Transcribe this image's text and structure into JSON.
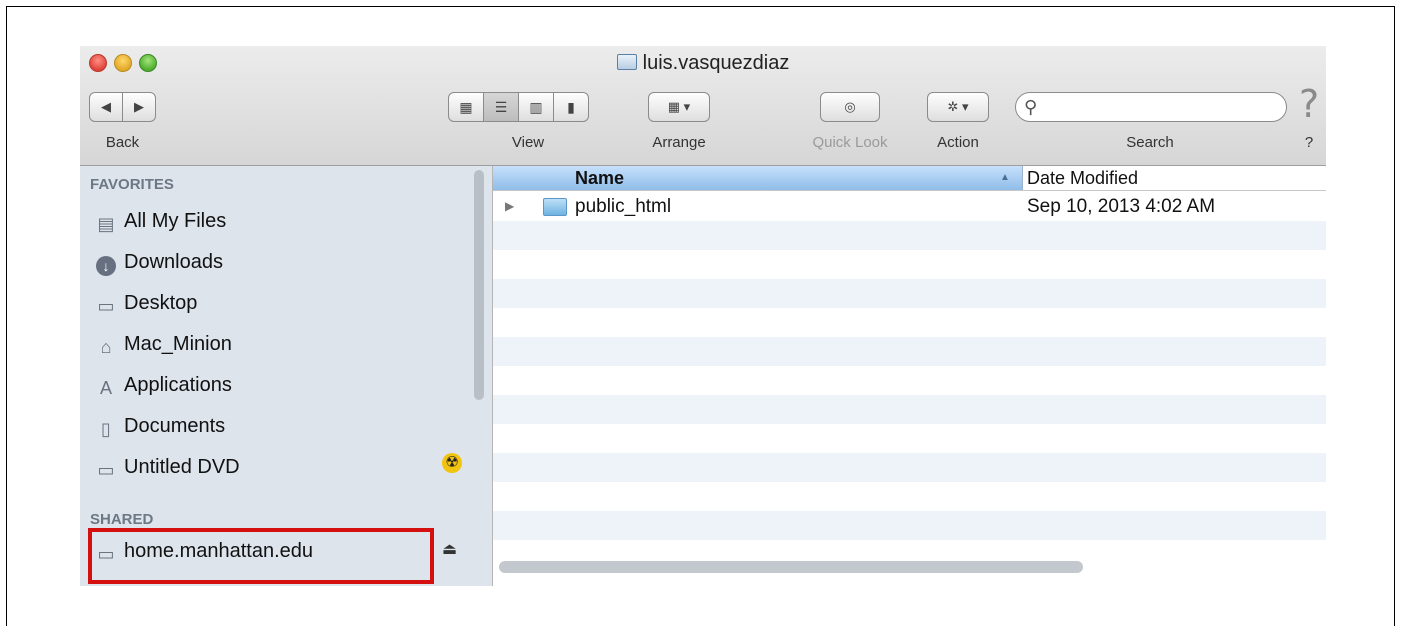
{
  "window": {
    "title": "luis.vasquezdiaz"
  },
  "toolbar": {
    "back_label": "Back",
    "view_label": "View",
    "arrange_label": "Arrange",
    "quicklook_label": "Quick Look",
    "action_label": "Action",
    "search_label": "Search",
    "help_label": "?",
    "search_placeholder": "",
    "help_glyph": "?"
  },
  "sidebar": {
    "favorites_header": "FAVORITES",
    "shared_header": "SHARED",
    "favorites": [
      {
        "label": "All My Files",
        "icon": "all-my-files-icon"
      },
      {
        "label": "Downloads",
        "icon": "downloads-icon"
      },
      {
        "label": "Desktop",
        "icon": "desktop-icon"
      },
      {
        "label": "Mac_Minion",
        "icon": "home-icon"
      },
      {
        "label": "Applications",
        "icon": "applications-icon"
      },
      {
        "label": "Documents",
        "icon": "documents-icon"
      },
      {
        "label": "Untitled DVD",
        "icon": "folder-icon"
      }
    ],
    "shared": [
      {
        "label": "home.manhattan.edu",
        "icon": "server-icon"
      }
    ]
  },
  "columns": {
    "name": "Name",
    "date_modified": "Date Modified"
  },
  "files": [
    {
      "name": "public_html",
      "date_modified": "Sep 10, 2013 4:02 AM"
    }
  ],
  "colors": {
    "highlight": "#d40f0f",
    "sidebar_bg": "#dde4ec",
    "selected_column": "#8fbde9"
  }
}
